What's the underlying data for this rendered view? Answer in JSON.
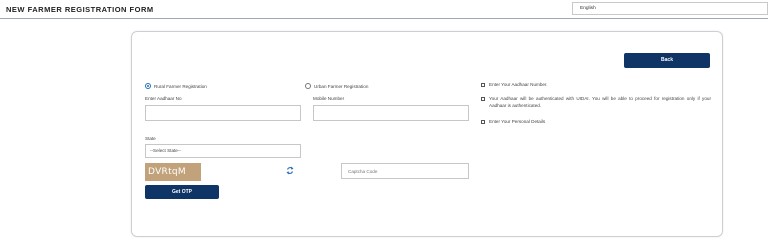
{
  "header": {
    "title": "NEW FARMER REGISTRATION FORM",
    "language": "English"
  },
  "form": {
    "back_label": "Back",
    "radio_rural": "Rural Farmer Registration",
    "radio_urban": "Urban Farmer Registration",
    "selected_type": "rural",
    "aadhaar_label": "Enter Aadhaar No",
    "aadhaar_value": "",
    "mobile_label": "Mobile Number",
    "mobile_value": "",
    "state_label": "State",
    "state_selected": "--Select State--",
    "captcha_text": "DVRtqM",
    "captcha_placeholder": "Captcha Code",
    "get_otp_label": "Get OTP"
  },
  "instructions": [
    "Enter Your Aadhaar Number.",
    "Your Aadhaar will be authenticated with UIDAI. You will be able to proceed for registration only if your Aadhaar is authenticated.",
    "Enter Your Personal Details"
  ],
  "colors": {
    "primary_button": "#0f3566",
    "captcha_bg": "#c2a27a",
    "radio_accent": "#1e73be"
  }
}
